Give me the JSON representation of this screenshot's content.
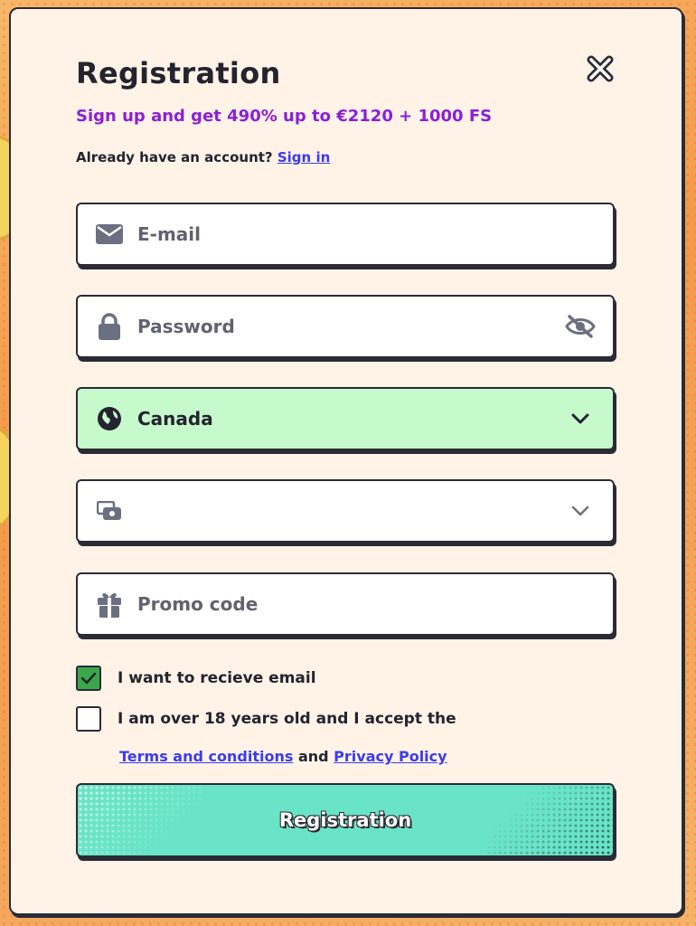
{
  "modal": {
    "title": "Registration",
    "subtitle": "Sign up and get 490% up to €2120 + 1000 FS",
    "signin_prompt": "Already have an account?",
    "signin_link": "Sign in"
  },
  "fields": {
    "email": {
      "placeholder": "E-mail",
      "icon": "envelope-icon"
    },
    "password": {
      "placeholder": "Password",
      "icon": "lock-icon",
      "toggle_icon": "eye-off-icon"
    },
    "country": {
      "value": "Canada",
      "icon": "globe-icon",
      "highlight_color": "#c6f9cc"
    },
    "currency": {
      "value": "",
      "icon": "wallet-icon"
    },
    "promo": {
      "placeholder": "Promo code",
      "icon": "gift-icon"
    }
  },
  "checkboxes": {
    "email_opt_in": {
      "label": "I want to recieve email",
      "checked": true
    },
    "age_terms": {
      "label": "I am over 18 years old and I accept the",
      "checked": false
    }
  },
  "terms": {
    "terms_link": "Terms and conditions",
    "and_text": "and",
    "privacy_link": "Privacy Policy"
  },
  "submit": {
    "label": "Registration",
    "color": "#6ae4c6"
  },
  "colors": {
    "accent_purple": "#8a1fd8",
    "link_blue": "#3b3bf0",
    "check_green": "#3aa84a"
  }
}
